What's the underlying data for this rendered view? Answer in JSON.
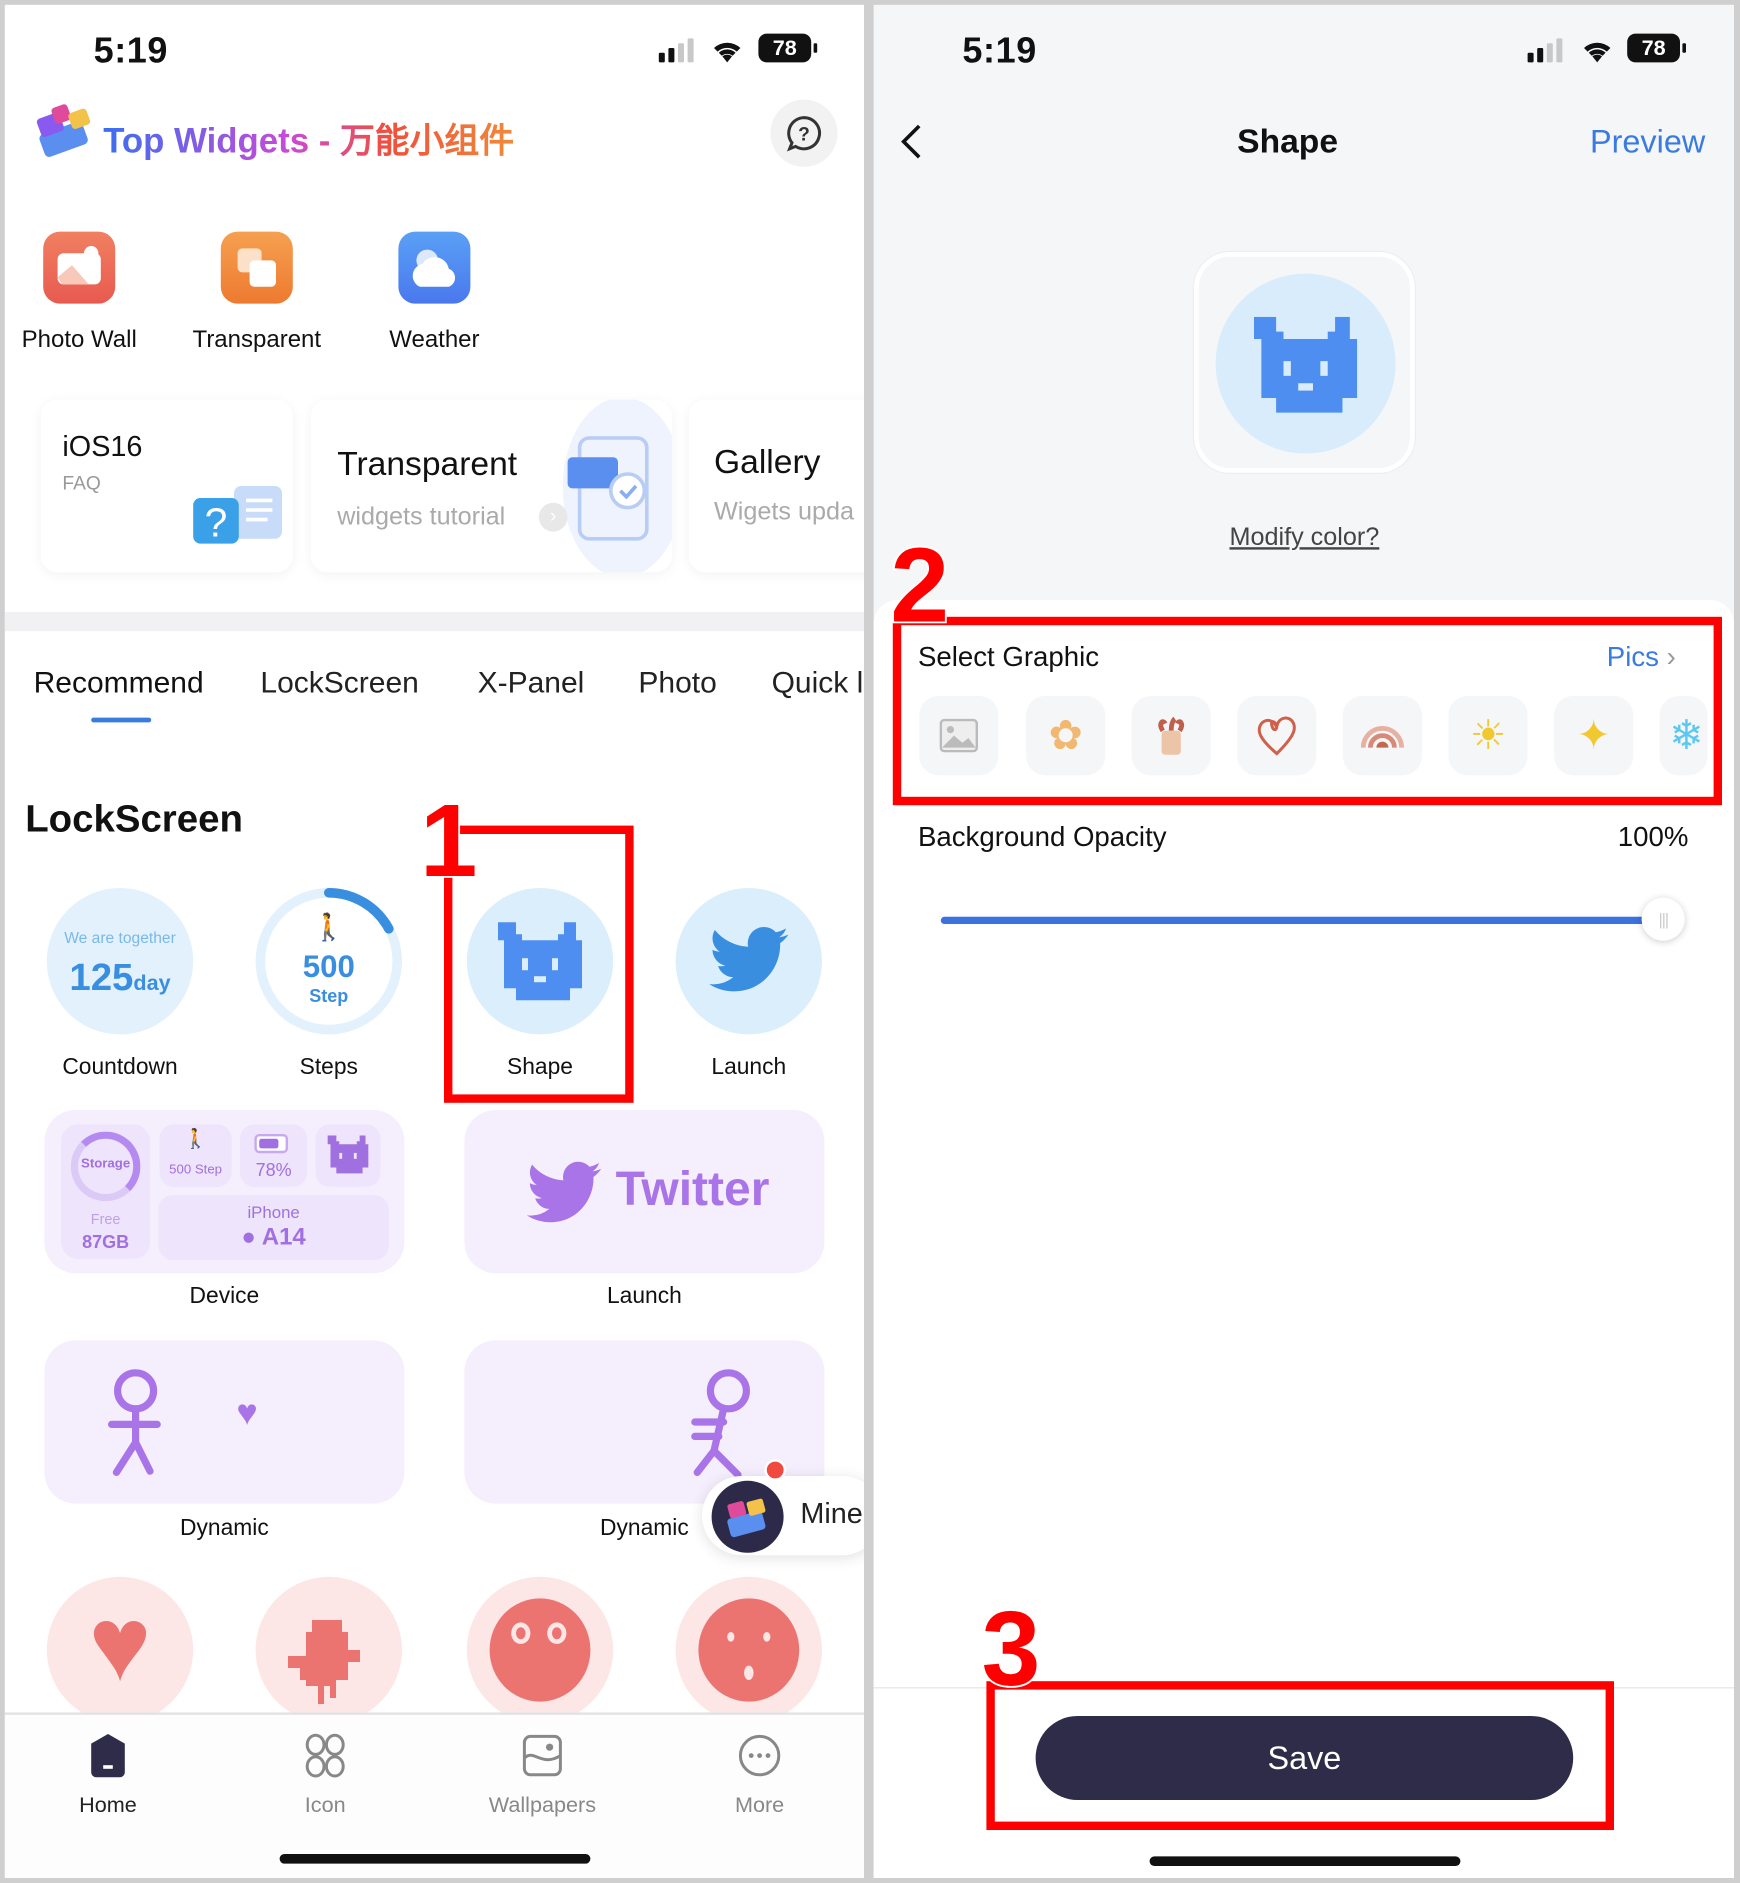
{
  "status_bar": {
    "time": "5:19",
    "battery": "78"
  },
  "left_screen": {
    "app_title": "Top Widgets - 万能小组件",
    "help_icon": "question-bubble-icon",
    "quick_actions": [
      {
        "label": "Photo Wall",
        "icon": "photo-icon",
        "color": "#ee6a5a"
      },
      {
        "label": "Transparent",
        "icon": "layers-icon",
        "color": "#f08a3a"
      },
      {
        "label": "Weather",
        "icon": "cloud-icon",
        "color": "#4e8ff2"
      }
    ],
    "banners": [
      {
        "title": "iOS16",
        "subtitle": "FAQ"
      },
      {
        "title": "Transparent",
        "subtitle": "widgets tutorial"
      },
      {
        "title": "Gallery",
        "subtitle": "Wigets upda"
      }
    ],
    "tabs": [
      "Recommend",
      "LockScreen",
      "X-Panel",
      "Photo",
      "Quick l"
    ],
    "active_tab": "Recommend",
    "section_title": "LockScreen",
    "lock_widgets": [
      {
        "label": "Countdown",
        "top": "We are together",
        "value": "125",
        "unit": "day"
      },
      {
        "label": "Steps",
        "value": "500",
        "unit": "Step"
      },
      {
        "label": "Shape"
      },
      {
        "label": "Launch"
      }
    ],
    "device_widget": {
      "label": "Device",
      "storage": "Storage",
      "free": "Free",
      "free_value": "87GB",
      "steps": "500 Step",
      "battery": "78%",
      "device": "iPhone",
      "chip": "A14"
    },
    "twitter_widget": {
      "label": "Launch",
      "text": "Twitter"
    },
    "dynamic_widgets": [
      "Dynamic",
      "Dynamic"
    ],
    "mine_button": "Mine",
    "bottom_nav": [
      {
        "label": "Home",
        "icon": "home-icon",
        "active": true
      },
      {
        "label": "Icon",
        "icon": "grid-icon"
      },
      {
        "label": "Wallpapers",
        "icon": "wallpaper-icon"
      },
      {
        "label": "More",
        "icon": "more-icon"
      }
    ]
  },
  "right_screen": {
    "back_icon": "chevron-left-icon",
    "title": "Shape",
    "preview": "Preview",
    "modify_color": "Modify color?",
    "select_graphic": "Select Graphic",
    "pics": "Pics",
    "graphics": [
      "image-placeholder-icon",
      "flower-icon",
      "plant-pot-icon",
      "heart-icon",
      "rainbow-icon",
      "sun-icon",
      "sparkle-icon",
      "snowflake-icon"
    ],
    "opacity_label": "Background Opacity",
    "opacity_value": "100%",
    "opacity_fraction": 1.0,
    "save": "Save"
  },
  "annotations": [
    "1",
    "2",
    "3"
  ],
  "colors": {
    "accent_blue": "#3a7be0",
    "annotation_red": "#ff0000",
    "save_bg": "#2e2c48",
    "widget_purple": "#a874e8",
    "shape_blue": "#4d8ef0"
  }
}
